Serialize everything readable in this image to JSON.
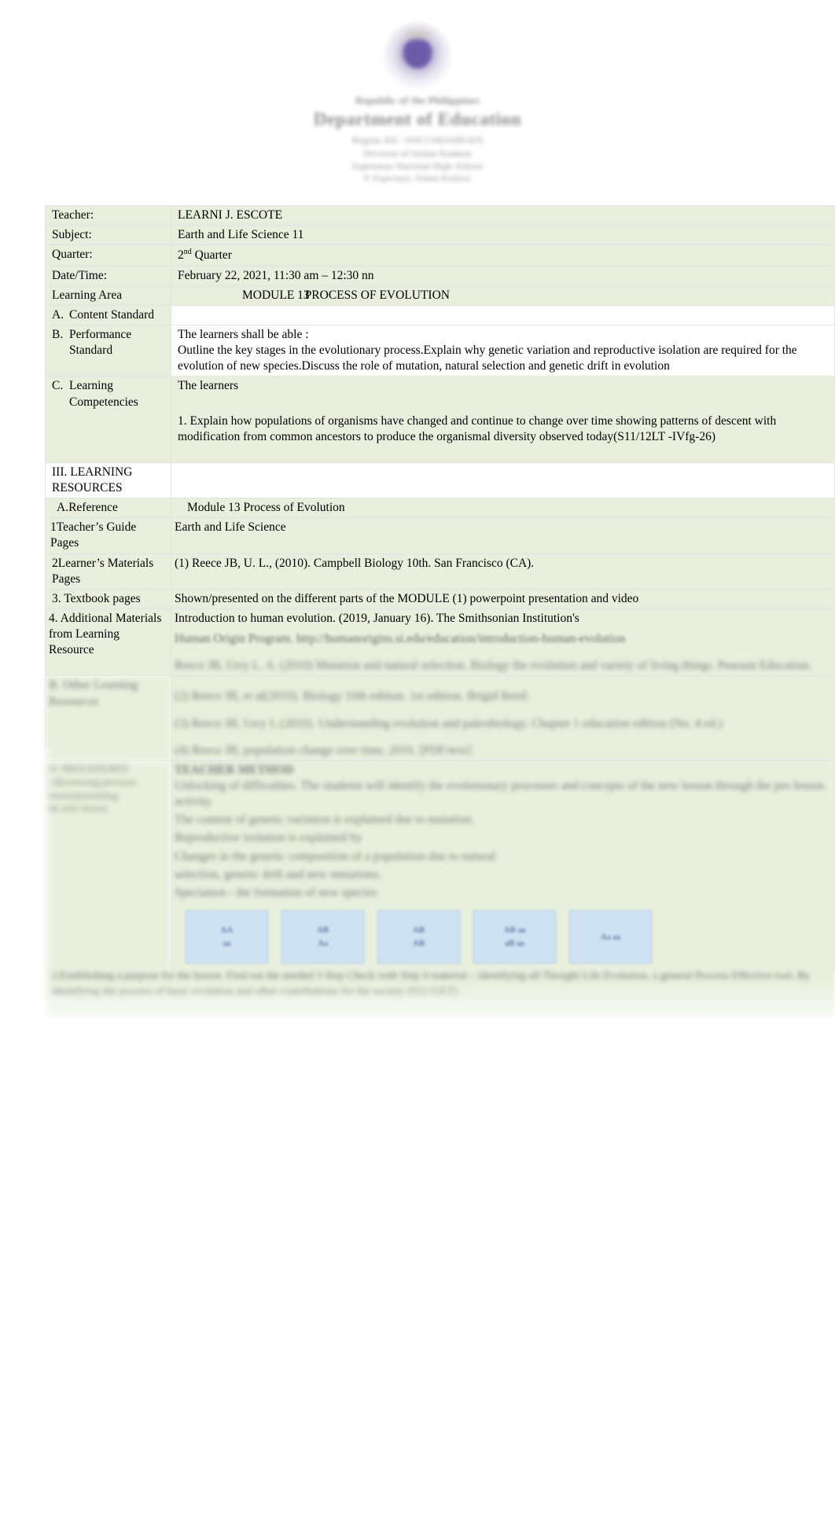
{
  "letterhead": {
    "republic": "Republic of the Philippines",
    "department": "Department of Education",
    "region": "Region XII - SOCCSKSARGEN",
    "division": "Division of Sultan Kudarat",
    "school": "Esperanza National High School",
    "address": "P. Esperanza, Sultan Kudarat"
  },
  "info": {
    "teacher_label": "Teacher:",
    "teacher_value": "LEARNI J. ESCOTE",
    "subject_label": "Subject:",
    "subject_value": "Earth and Life Science 11",
    "quarter_label": "Quarter:",
    "quarter_value_num": "2",
    "quarter_value_sup": "nd",
    "quarter_value_rest": " Quarter",
    "datetime_label": "Date/Time:",
    "datetime_value": "February 22, 2021, 11:30 am – 12:30 nn",
    "learning_area_label": "Learning Area",
    "learning_area_value_a": "MODULE 13",
    "learning_area_value_b": "PROCESS OF EVOLUTION"
  },
  "standards": {
    "content_letter": "A.",
    "content_label": "Content Standard",
    "content_value": "",
    "performance_letter": "B.",
    "performance_label_line1": "Performance",
    "performance_label_line2": "Standard",
    "performance_intro": "The learners shall be able :",
    "performance_body": "Outline the key stages in the evolutionary process.Explain why genetic variation and reproductive isolation are required for the evolution of new species.Discuss the role of mutation, natural selection and genetic drift in evolution",
    "competency_letter": "C.",
    "competency_label_line1": "Learning",
    "competency_label_line2": "Competencies",
    "competency_intro": "The learners",
    "competency_item1": "1. Explain how populations of organisms have changed and continue to change over time showing patterns of descent with modification from common ancestors to produce the organismal diversity observed today(S11/12LT -IVfg-26)"
  },
  "resources": {
    "section_line1": "III. LEARNING",
    "section_line2": "RESOURCES",
    "section_value": "",
    "reference_label": "A.Reference",
    "reference_value": "Module 13 Process of Evolution",
    "tg_label": "1Teacher’s Guide Pages",
    "tg_value": "Earth and Life Science",
    "lm_label_line1": "2Learner’s Materials",
    "lm_label_line2": "Pages",
    "lm_value": "(1) Reece JB, U. L., (2010). Campbell Biology 10th. San Francisco (CA).",
    "textbook_label": "3. Textbook pages",
    "textbook_value": "Shown/presented on the different parts of the MODULE (1) powerpoint presentation and video",
    "additional_label_line1": "4. Additional Materials",
    "additional_label_line2": "from Learning Resource",
    "additional_value_1": "Introduction to human evolution. (2019, January 16). The Smithsonian Institution's",
    "additional_value_2": "Human Origin Program. http://humanorigins.si.edu/education/introduction-human-evolution",
    "additional_value_3": "Reece JB, Urry L. A. (2010) Mutation and natural selection. Biology the evolution and variety of living things. Pearson Education.",
    "other_label_line1": "B. Other Learning",
    "other_label_line2": "Resources",
    "other_value_1": "(2) Reece JB, et al(2010). Biology 10th edition. 1st edition. Brigid Reed.",
    "other_value_2": "(3) Reece JB, Urry L (2010). Understanding evolution and paleobiology. Chapter 1 education edition (No. 4 ed.)",
    "other_value_3": "(4) Reece JB, population change over time, 2010. [PDF/text]"
  },
  "procedures": {
    "heading_left_line1": "IV. PROCEDURES",
    "heading_left_line2": "1.Reviewing previous",
    "heading_left_line3": "lesson/presenting",
    "heading_left_line4": "the new lesson",
    "heading_right": "TEACHER METHOD",
    "body_1": "Unlocking of difficulties. The students will identify the evolutionary processes and concepts of the new lesson through the pre-lesson activity.",
    "body_2": "The content of  genetic variation   is explained due to     mutation.",
    "body_3": "Reproductive isolation      is explained by      ",
    "body_4": "Changes in the genetic composition of a population due to              natural",
    "body_5": "selection,      genetic drift      and     new mutations.",
    "body_6": "Speciation      -  the formation of new species",
    "boxes": [
      {
        "line1": "AA",
        "line2": "aa"
      },
      {
        "line1": "AB",
        "line2": "Aa"
      },
      {
        "line1": "AB",
        "line2": "AB"
      },
      {
        "line1": "AB aa",
        "line2": "aB aa"
      },
      {
        "line1": "Aa aa",
        "line2": ""
      }
    ]
  },
  "closing": {
    "line1": "2.Establishing a purpose for the lesson. Find out the needed 3 Step Check with Step 4 material – identifying all Thought Life Evolution, a general Process Effective tool, By Identifying the process of basic evolution and other contributions for the society (S11/12LT)"
  },
  "colors": {
    "cell_green": "#e9efdd",
    "box_blue": "#cfe2f3",
    "box_blue_border": "#9fc5e8",
    "seal_purple": "#6b5aa8"
  }
}
